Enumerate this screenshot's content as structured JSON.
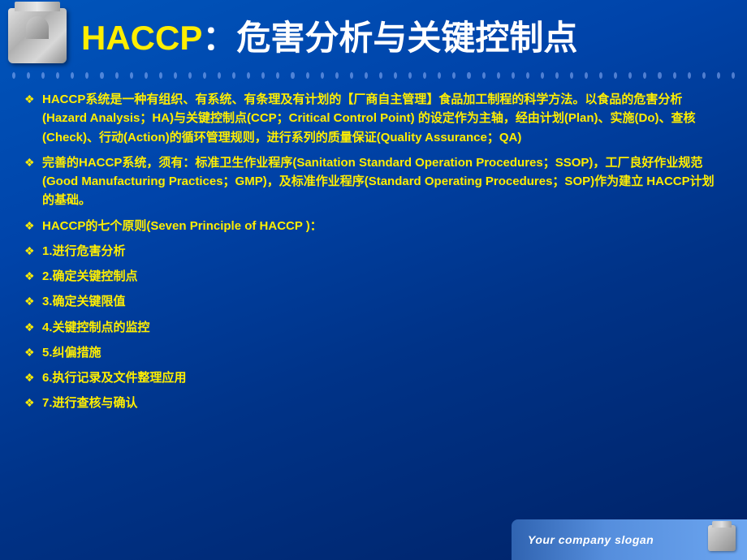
{
  "header": {
    "title_haccp": "HACCP",
    "title_colon": "：",
    "title_rest": "危害分析与关键控制点"
  },
  "content": {
    "items": [
      {
        "id": 1,
        "text": "HACCP系统是一种有组织、有系统、有条理及有计划的【厂商自主管理】食品加工制程的科学方法。以食品的危害分析(Hazard Analysis；HA)与关键控制点(CCP；Critical Control Point) 的设定作为主轴，经由计划(Plan)、实施(Do)、查核(Check)、行动(Action)的循环管理规则，进行系列的质量保证(Quality Assurance；QA)"
      },
      {
        "id": 2,
        "text": "完善的HACCP系统，须有：标准卫生作业程序(Sanitation Standard Operation Procedures；SSOP)，工厂良好作业规范(Good Manufacturing Practices；GMP)，及标准作业程序(Standard Operating Procedures；SOP)作为建立 HACCP计划的基础。"
      },
      {
        "id": 3,
        "text": "HACCP的七个原则(Seven Principle of HACCP )："
      },
      {
        "id": 4,
        "text": "1.进行危害分析"
      },
      {
        "id": 5,
        "text": "2.确定关键控制点"
      },
      {
        "id": 6,
        "text": "3.确定关键限值"
      },
      {
        "id": 7,
        "text": "4.关键控制点的监控"
      },
      {
        "id": 8,
        "text": "5.纠偏措施"
      },
      {
        "id": 9,
        "text": "6.执行记录及文件整理应用"
      },
      {
        "id": 10,
        "text": "7.进行查核与确认"
      }
    ]
  },
  "footer": {
    "slogan": "Your company slogan"
  },
  "dots": {
    "count": 20
  }
}
